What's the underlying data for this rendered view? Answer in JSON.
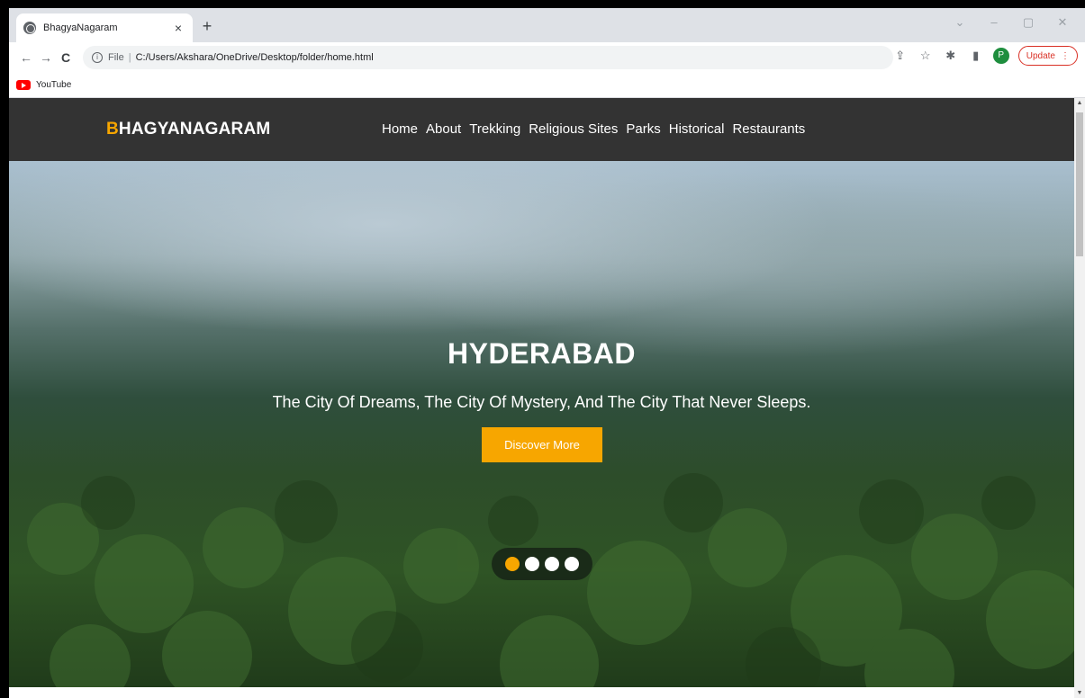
{
  "browser": {
    "tab_title": "BhagyaNagaram",
    "tab_close": "×",
    "new_tab": "+",
    "window_controls": [
      "⌄",
      "–",
      "▢",
      "✕"
    ],
    "nav": {
      "back": "←",
      "forward": "→",
      "reload": "C"
    },
    "omnibox": {
      "info": "i",
      "scheme_label": "File",
      "separator": "|",
      "url": "C:/Users/Akshara/OneDrive/Desktop/folder/home.html"
    },
    "tools": {
      "share": "⇪",
      "star": "☆",
      "extensions": "✱",
      "sidebar": "▮"
    },
    "profile_initial": "P",
    "update_label": "Update",
    "update_menu": "⋮",
    "bookmarks": [
      {
        "label": "YouTube",
        "icon": "youtube-icon"
      }
    ]
  },
  "site": {
    "brand_accent": "B",
    "brand_rest": "HAGYANAGARAM",
    "accent_color": "#f7a600",
    "menu": [
      "Home",
      "About",
      "Trekking",
      "Religious Sites",
      "Parks",
      "Historical",
      "Restaurants"
    ],
    "hero": {
      "title": "HYDERABAD",
      "subtitle": "The City Of Dreams, The City Of Mystery, And The City That Never Sleeps.",
      "button_label": "Discover More",
      "slides_total": 4,
      "active_slide": 1
    }
  },
  "scrollbar": {
    "up": "▲",
    "down": "▼"
  }
}
